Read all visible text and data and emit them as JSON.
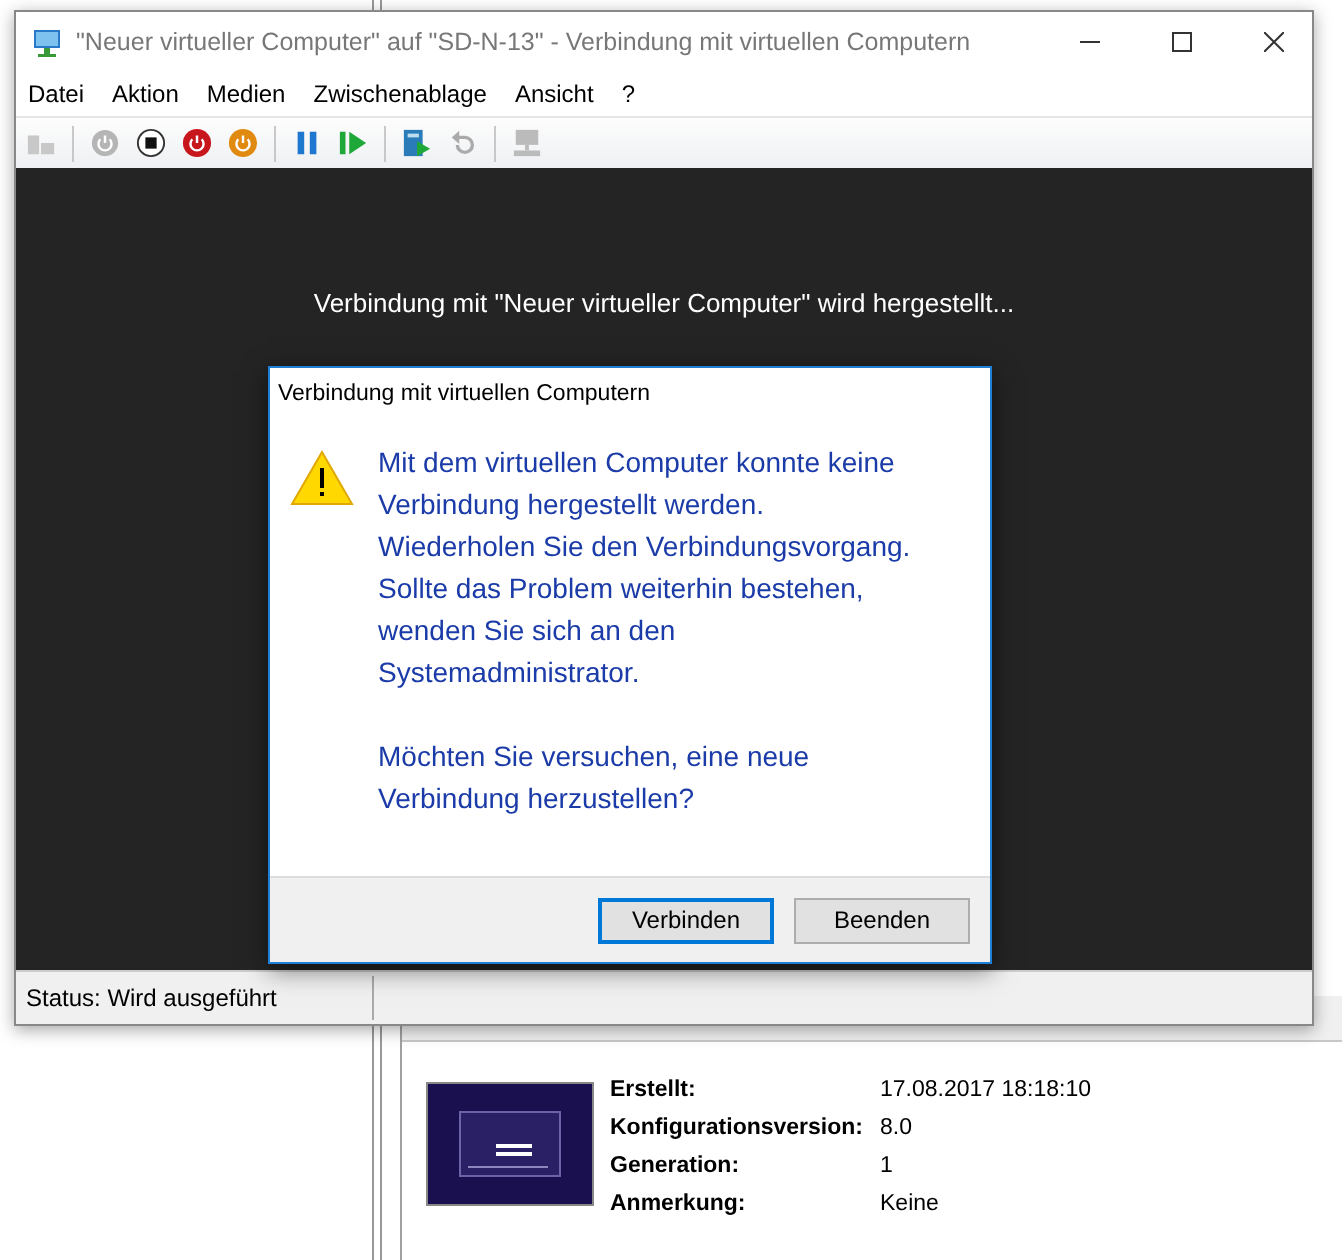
{
  "window": {
    "title": "\"Neuer virtueller Computer\" auf \"SD-N-13\" - Verbindung mit virtuellen Computern"
  },
  "menu": [
    "Datei",
    "Aktion",
    "Medien",
    "Zwischenablage",
    "Ansicht",
    "?"
  ],
  "screen": {
    "message": "Verbindung mit \"Neuer virtueller Computer\" wird hergestellt..."
  },
  "dialog": {
    "title": "Verbindung mit virtuellen Computern",
    "paragraphs": [
      "Mit dem virtuellen Computer konnte keine Verbindung hergestellt werden. Wiederholen Sie den Verbindungsvorgang. Sollte das Problem weiterhin bestehen, wenden Sie sich an den Systemadministrator.",
      "Möchten Sie versuchen, eine neue Verbindung herzustellen?"
    ],
    "buttons": [
      {
        "label": "Verbinden",
        "selected": true
      },
      {
        "label": "Beenden",
        "selected": false
      }
    ]
  },
  "status_bar": {
    "text": "Status: Wird ausgeführt"
  },
  "details": {
    "rows": [
      {
        "label": "Erstellt:",
        "value": "17.08.2017 18:18:10"
      },
      {
        "label": "Konfigurationsversion:",
        "value": "8.0"
      },
      {
        "label": "Generation:",
        "value": "1"
      },
      {
        "label": "Anmerkung:",
        "value": "Keine"
      }
    ]
  }
}
